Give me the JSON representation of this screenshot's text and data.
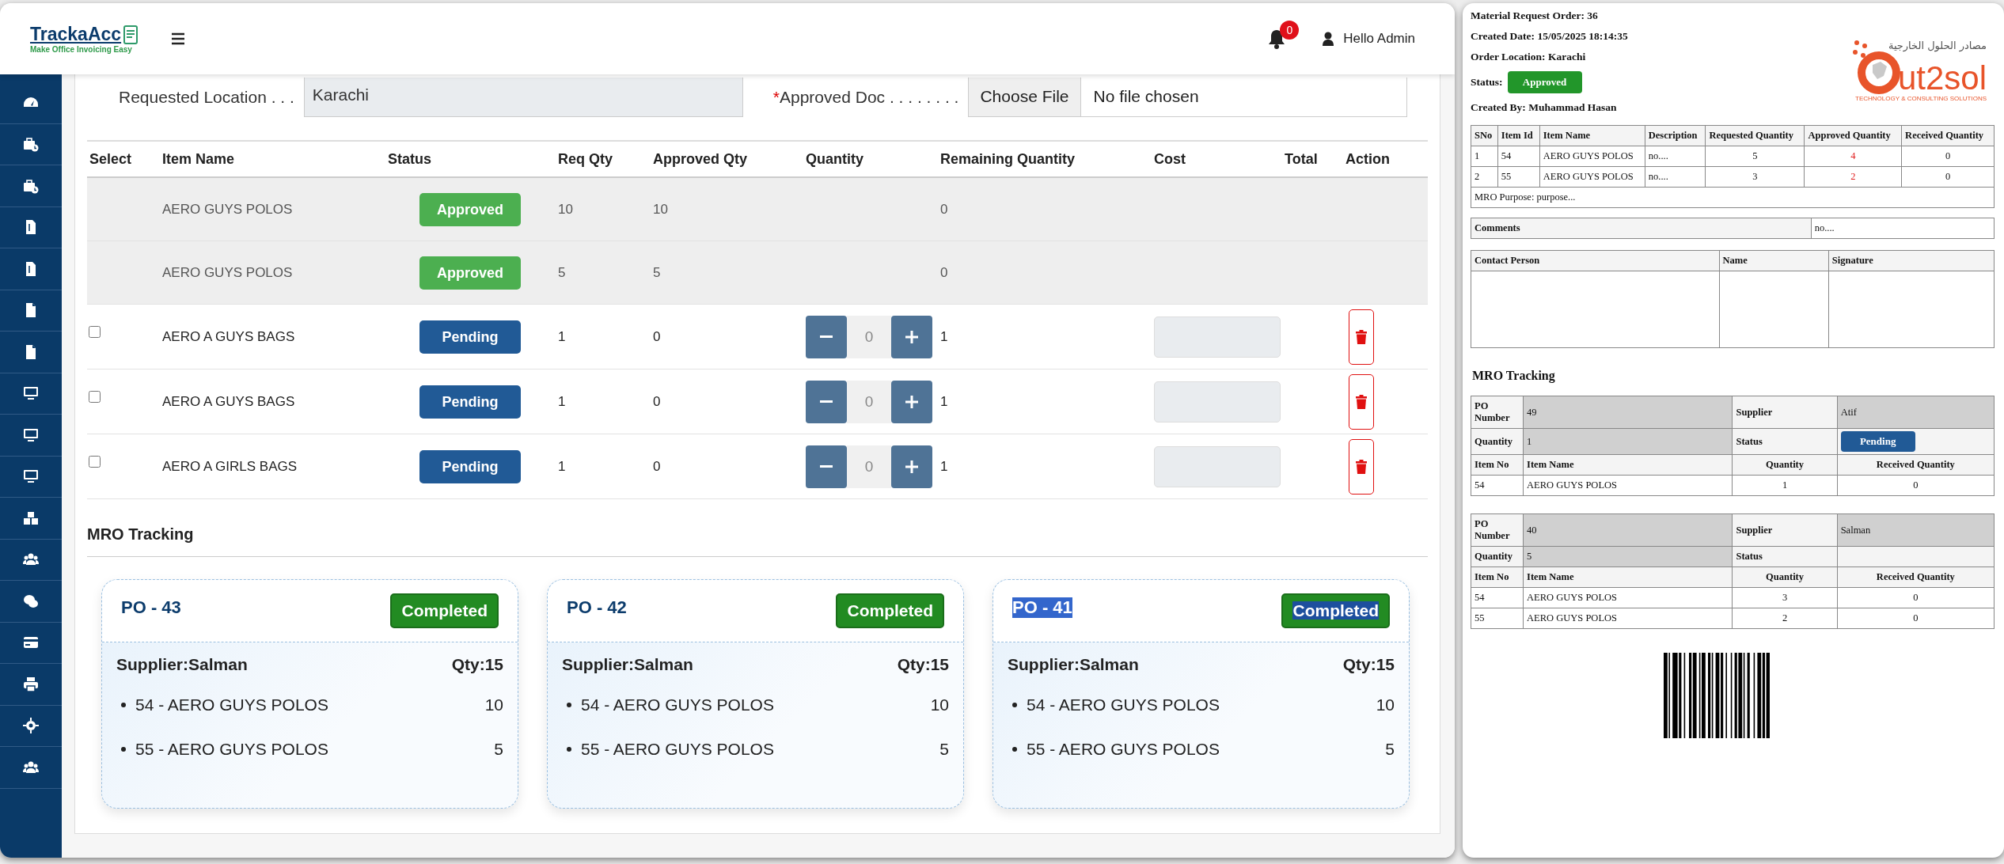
{
  "header": {
    "logo_name": "TrackaAcc",
    "logo_tagline": "Make Office Invoicing Easy",
    "notification_count": "0",
    "user": "Hello Admin"
  },
  "form": {
    "location_label": "Requested Location . . .",
    "location_value": "Karachi",
    "required_mark": "*",
    "doc_label": "Approved Doc . . . . . . . .",
    "file_button": "Choose File",
    "file_status": "No file chosen"
  },
  "table": {
    "columns": [
      "Select",
      "Item Name",
      "Status",
      "Req Qty",
      "Approved Qty",
      "Quantity",
      "Remaining Quantity",
      "Cost",
      "Total",
      "Action"
    ],
    "rows": [
      {
        "kind": "approved",
        "item": "AERO GUYS POLOS",
        "status": "Approved",
        "req_qty": "10",
        "approved_qty": "10",
        "remaining": "0"
      },
      {
        "kind": "approved",
        "item": "AERO GUYS POLOS",
        "status": "Approved",
        "req_qty": "5",
        "approved_qty": "5",
        "remaining": "0"
      },
      {
        "kind": "pending",
        "checked": false,
        "item": "AERO A GUYS BAGS",
        "status": "Pending",
        "req_qty": "1",
        "approved_qty": "0",
        "quantity": "0",
        "remaining": "1"
      },
      {
        "kind": "pending",
        "checked": false,
        "item": "AERO A GUYS BAGS",
        "status": "Pending",
        "req_qty": "1",
        "approved_qty": "0",
        "quantity": "0",
        "remaining": "1"
      },
      {
        "kind": "pending",
        "checked": false,
        "item": "AERO A GIRLS BAGS",
        "status": "Pending",
        "req_qty": "1",
        "approved_qty": "0",
        "quantity": "0",
        "remaining": "1"
      }
    ]
  },
  "tracking": {
    "title": "MRO Tracking",
    "cards": [
      {
        "po": "PO - 43",
        "status": "Completed",
        "supplier": "Supplier:Salman",
        "qty": "Qty:15",
        "text_selected": false,
        "items": [
          {
            "name": "54 - AERO GUYS POLOS",
            "qty": "10"
          },
          {
            "name": "55 - AERO GUYS POLOS",
            "qty": "5"
          }
        ]
      },
      {
        "po": "PO - 42",
        "status": "Completed",
        "supplier": "Supplier:Salman",
        "qty": "Qty:15",
        "text_selected": false,
        "items": [
          {
            "name": "54 - AERO GUYS POLOS",
            "qty": "10"
          },
          {
            "name": "55 - AERO GUYS POLOS",
            "qty": "5"
          }
        ]
      },
      {
        "po": "PO - 41",
        "status": "Completed",
        "supplier": "Supplier:Salman",
        "qty": "Qty:15",
        "text_selected": true,
        "items": [
          {
            "name": "54 - AERO GUYS POLOS",
            "qty": "10"
          },
          {
            "name": "55 - AERO GUYS POLOS",
            "qty": "5"
          }
        ]
      }
    ]
  },
  "document": {
    "info_lines": [
      "Material Request Order: 36",
      "Created Date: 15/05/2025 18:14:35",
      "Order Location: Karachi"
    ],
    "status_label": "Status:",
    "status": "Approved",
    "created_by": "Created By: Muhammad Hasan",
    "logo": {
      "arabic": "مصادر الحلول الخارجية",
      "brand": "ut2sol",
      "tagline": "TECHNOLOGY & CONSULTING SOLUTIONS"
    },
    "items_columns": [
      "SNo",
      "Item Id",
      "Item Name",
      "Description",
      "Requested Quantity",
      "Approved Quantity",
      "Received Quantity"
    ],
    "items": [
      [
        "1",
        "54",
        "AERO GUYS POLOS",
        "no....",
        "5",
        "4",
        "0"
      ],
      [
        "2",
        "55",
        "AERO GUYS POLOS",
        "no....",
        "3",
        "2",
        "0"
      ]
    ],
    "purpose": "MRO Purpose: purpose...",
    "comments_label": "Comments",
    "comments": "no....",
    "signature_columns": [
      "Contact Person",
      "Name",
      "Signature"
    ],
    "tracking_title": "MRO Tracking",
    "pos": [
      {
        "po_label": "PO Number",
        "po": "49",
        "supplier_label": "Supplier",
        "supplier": "Atif",
        "qty_label": "Quantity",
        "qty": "1",
        "status_label": "Status",
        "status": "Pending",
        "columns": [
          "Item No",
          "Item Name",
          "Quantity",
          "Received Quantity"
        ],
        "items": [
          [
            "54",
            "AERO GUYS POLOS",
            "1",
            "0"
          ]
        ]
      },
      {
        "po_label": "PO Number",
        "po": "40",
        "supplier_label": "Supplier",
        "supplier": "Salman",
        "qty_label": "Quantity",
        "qty": "5",
        "status_label": "Status",
        "columns": [
          "Item No",
          "Item Name",
          "Quantity",
          "Received Quantity"
        ],
        "items": [
          [
            "54",
            "AERO GUYS POLOS",
            "3",
            "0"
          ],
          [
            "55",
            "AERO GUYS POLOS",
            "2",
            "0"
          ]
        ]
      }
    ]
  }
}
